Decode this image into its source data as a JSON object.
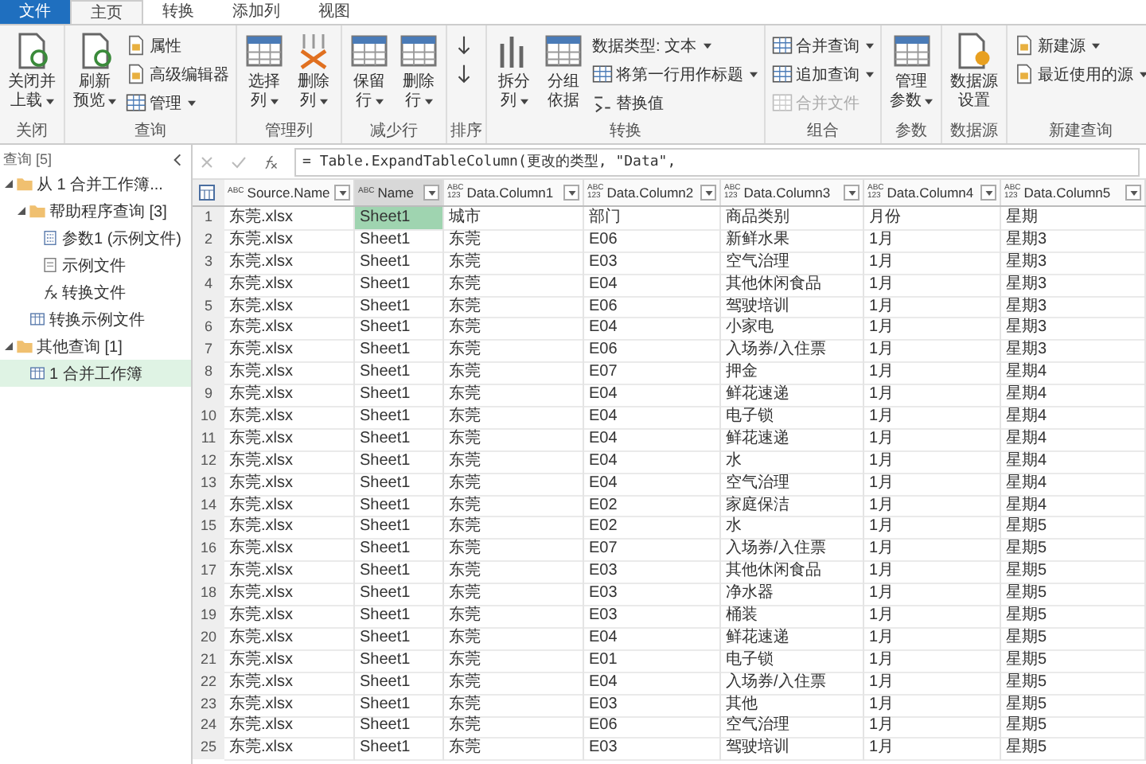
{
  "tabs": [
    {
      "label": "文件",
      "kind": "file",
      "selected": false
    },
    {
      "label": "主页",
      "kind": "tab",
      "selected": true
    },
    {
      "label": "转换",
      "kind": "tab",
      "selected": false
    },
    {
      "label": "添加列",
      "kind": "tab",
      "selected": false
    },
    {
      "label": "视图",
      "kind": "tab",
      "selected": false
    }
  ],
  "ribbon": {
    "groups": [
      {
        "label": "关闭",
        "items": [
          {
            "kind": "large",
            "lines": [
              "关闭并",
              "上载"
            ],
            "menu": true
          }
        ]
      },
      {
        "label": "查询",
        "items": [
          {
            "kind": "large",
            "lines": [
              "刷新",
              "预览"
            ],
            "menu": true
          },
          {
            "kind": "stack",
            "buttons": [
              {
                "label": "属性",
                "menu": false,
                "disabled": false
              },
              {
                "label": "高级编辑器",
                "menu": false,
                "disabled": false
              },
              {
                "label": "管理",
                "menu": true,
                "disabled": false
              }
            ]
          }
        ]
      },
      {
        "label": "管理列",
        "items": [
          {
            "kind": "large",
            "lines": [
              "选择",
              "列"
            ],
            "menu": true
          },
          {
            "kind": "large",
            "lines": [
              "删除",
              "列"
            ],
            "menu": true
          }
        ]
      },
      {
        "label": "减少行",
        "items": [
          {
            "kind": "large",
            "lines": [
              "保留",
              "行"
            ],
            "menu": true
          },
          {
            "kind": "large",
            "lines": [
              "删除",
              "行"
            ],
            "menu": true
          }
        ]
      },
      {
        "label": "排序",
        "items": [
          {
            "kind": "stack",
            "buttons": [
              {
                "menu": false,
                "disabled": false
              },
              {
                "menu": false,
                "disabled": false
              }
            ]
          }
        ]
      },
      {
        "label": "转换",
        "items": [
          {
            "kind": "large",
            "lines": [
              "拆分",
              "列"
            ],
            "menu": true
          },
          {
            "kind": "large",
            "lines": [
              "分组",
              "依据"
            ],
            "menu": false
          },
          {
            "kind": "stack",
            "buttons": [
              {
                "label": "数据类型: 文本",
                "menu": true,
                "disabled": false
              },
              {
                "label": "将第一行用作标题",
                "menu": true,
                "disabled": false
              },
              {
                "label": "替换值",
                "menu": false,
                "disabled": false
              }
            ]
          }
        ]
      },
      {
        "label": "组合",
        "items": [
          {
            "kind": "stack",
            "buttons": [
              {
                "label": "合并查询",
                "menu": true,
                "disabled": false
              },
              {
                "label": "追加查询",
                "menu": true,
                "disabled": false
              },
              {
                "label": "合并文件",
                "menu": false,
                "disabled": true
              }
            ]
          }
        ]
      },
      {
        "label": "参数",
        "items": [
          {
            "kind": "large",
            "lines": [
              "管理",
              "参数"
            ],
            "menu": true
          }
        ]
      },
      {
        "label": "数据源",
        "items": [
          {
            "kind": "large",
            "lines": [
              "数据源",
              "设置"
            ],
            "menu": false
          }
        ]
      },
      {
        "label": "新建查询",
        "items": [
          {
            "kind": "stack",
            "buttons": [
              {
                "label": "新建源",
                "menu": true,
                "disabled": false
              },
              {
                "label": "最近使用的源",
                "menu": true,
                "disabled": false
              }
            ]
          }
        ]
      }
    ]
  },
  "queries": {
    "title": "查询 [5]",
    "items": [
      {
        "label": "从 1 合并工作簿...",
        "expanded": true,
        "selected": false,
        "children": [
          {
            "label": "帮助程序查询 [3]",
            "expanded": true,
            "selected": false,
            "children": [
              {
                "label": "参数1 (示例文件)",
                "selected": false
              },
              {
                "label": "示例文件",
                "selected": false
              },
              {
                "label": "转换文件",
                "selected": false
              }
            ]
          },
          {
            "label": "转换示例文件",
            "selected": false
          }
        ]
      },
      {
        "label": "其他查询 [1]",
        "expanded": true,
        "selected": false,
        "children": [
          {
            "label": "1 合并工作簿",
            "selected": true
          }
        ]
      }
    ]
  },
  "formula": "= Table.ExpandTableColumn(更改的类型, \"Data\",",
  "table": {
    "columns": [
      {
        "name": "Source.Name",
        "type": "ABC",
        "selected": false
      },
      {
        "name": "Name",
        "type": "ABC",
        "selected": true
      },
      {
        "name": "Data.Column1",
        "type": "ABC\n123",
        "selected": false
      },
      {
        "name": "Data.Column2",
        "type": "ABC\n123",
        "selected": false
      },
      {
        "name": "Data.Column3",
        "type": "ABC\n123",
        "selected": false
      },
      {
        "name": "Data.Column4",
        "type": "ABC\n123",
        "selected": false
      },
      {
        "name": "Data.Column5",
        "type": "ABC\n123",
        "selected": false
      }
    ],
    "rows": [
      {
        "number": "1",
        "selected": true,
        "cells": [
          "东莞.xlsx",
          "Sheet1",
          "城市",
          "部门",
          "商品类别",
          "月份",
          "星期"
        ]
      },
      {
        "number": "2",
        "selected": false,
        "cells": [
          "东莞.xlsx",
          "Sheet1",
          "东莞",
          "E06",
          "新鲜水果",
          "1月",
          "星期3"
        ]
      },
      {
        "number": "3",
        "selected": false,
        "cells": [
          "东莞.xlsx",
          "Sheet1",
          "东莞",
          "E03",
          "空气治理",
          "1月",
          "星期3"
        ]
      },
      {
        "number": "4",
        "selected": false,
        "cells": [
          "东莞.xlsx",
          "Sheet1",
          "东莞",
          "E04",
          "其他休闲食品",
          "1月",
          "星期3"
        ]
      },
      {
        "number": "5",
        "selected": false,
        "cells": [
          "东莞.xlsx",
          "Sheet1",
          "东莞",
          "E06",
          "驾驶培训",
          "1月",
          "星期3"
        ]
      },
      {
        "number": "6",
        "selected": false,
        "cells": [
          "东莞.xlsx",
          "Sheet1",
          "东莞",
          "E04",
          "小家电",
          "1月",
          "星期3"
        ]
      },
      {
        "number": "7",
        "selected": false,
        "cells": [
          "东莞.xlsx",
          "Sheet1",
          "东莞",
          "E06",
          "入场券/入住票",
          "1月",
          "星期3"
        ]
      },
      {
        "number": "8",
        "selected": false,
        "cells": [
          "东莞.xlsx",
          "Sheet1",
          "东莞",
          "E07",
          "押金",
          "1月",
          "星期4"
        ]
      },
      {
        "number": "9",
        "selected": false,
        "cells": [
          "东莞.xlsx",
          "Sheet1",
          "东莞",
          "E04",
          "鲜花速递",
          "1月",
          "星期4"
        ]
      },
      {
        "number": "10",
        "selected": false,
        "cells": [
          "东莞.xlsx",
          "Sheet1",
          "东莞",
          "E04",
          "电子锁",
          "1月",
          "星期4"
        ]
      },
      {
        "number": "11",
        "selected": false,
        "cells": [
          "东莞.xlsx",
          "Sheet1",
          "东莞",
          "E04",
          "鲜花速递",
          "1月",
          "星期4"
        ]
      },
      {
        "number": "12",
        "selected": false,
        "cells": [
          "东莞.xlsx",
          "Sheet1",
          "东莞",
          "E04",
          "水",
          "1月",
          "星期4"
        ]
      },
      {
        "number": "13",
        "selected": false,
        "cells": [
          "东莞.xlsx",
          "Sheet1",
          "东莞",
          "E04",
          "空气治理",
          "1月",
          "星期4"
        ]
      },
      {
        "number": "14",
        "selected": false,
        "cells": [
          "东莞.xlsx",
          "Sheet1",
          "东莞",
          "E02",
          "家庭保洁",
          "1月",
          "星期4"
        ]
      },
      {
        "number": "15",
        "selected": false,
        "cells": [
          "东莞.xlsx",
          "Sheet1",
          "东莞",
          "E02",
          "水",
          "1月",
          "星期5"
        ]
      },
      {
        "number": "16",
        "selected": false,
        "cells": [
          "东莞.xlsx",
          "Sheet1",
          "东莞",
          "E07",
          "入场券/入住票",
          "1月",
          "星期5"
        ]
      },
      {
        "number": "17",
        "selected": false,
        "cells": [
          "东莞.xlsx",
          "Sheet1",
          "东莞",
          "E03",
          "其他休闲食品",
          "1月",
          "星期5"
        ]
      },
      {
        "number": "18",
        "selected": false,
        "cells": [
          "东莞.xlsx",
          "Sheet1",
          "东莞",
          "E03",
          "净水器",
          "1月",
          "星期5"
        ]
      },
      {
        "number": "19",
        "selected": false,
        "cells": [
          "东莞.xlsx",
          "Sheet1",
          "东莞",
          "E03",
          "桶装",
          "1月",
          "星期5"
        ]
      },
      {
        "number": "20",
        "selected": false,
        "cells": [
          "东莞.xlsx",
          "Sheet1",
          "东莞",
          "E04",
          "鲜花速递",
          "1月",
          "星期5"
        ]
      },
      {
        "number": "21",
        "selected": false,
        "cells": [
          "东莞.xlsx",
          "Sheet1",
          "东莞",
          "E01",
          "电子锁",
          "1月",
          "星期5"
        ]
      },
      {
        "number": "22",
        "selected": false,
        "cells": [
          "东莞.xlsx",
          "Sheet1",
          "东莞",
          "E04",
          "入场券/入住票",
          "1月",
          "星期5"
        ]
      },
      {
        "number": "23",
        "selected": false,
        "cells": [
          "东莞.xlsx",
          "Sheet1",
          "东莞",
          "E03",
          "其他",
          "1月",
          "星期5"
        ]
      },
      {
        "number": "24",
        "selected": false,
        "cells": [
          "东莞.xlsx",
          "Sheet1",
          "东莞",
          "E06",
          "空气治理",
          "1月",
          "星期5"
        ]
      },
      {
        "number": "25",
        "selected": false,
        "cells": [
          "东莞.xlsx",
          "Sheet1",
          "东莞",
          "E03",
          "驾驶培训",
          "1月",
          "星期5"
        ]
      }
    ]
  }
}
